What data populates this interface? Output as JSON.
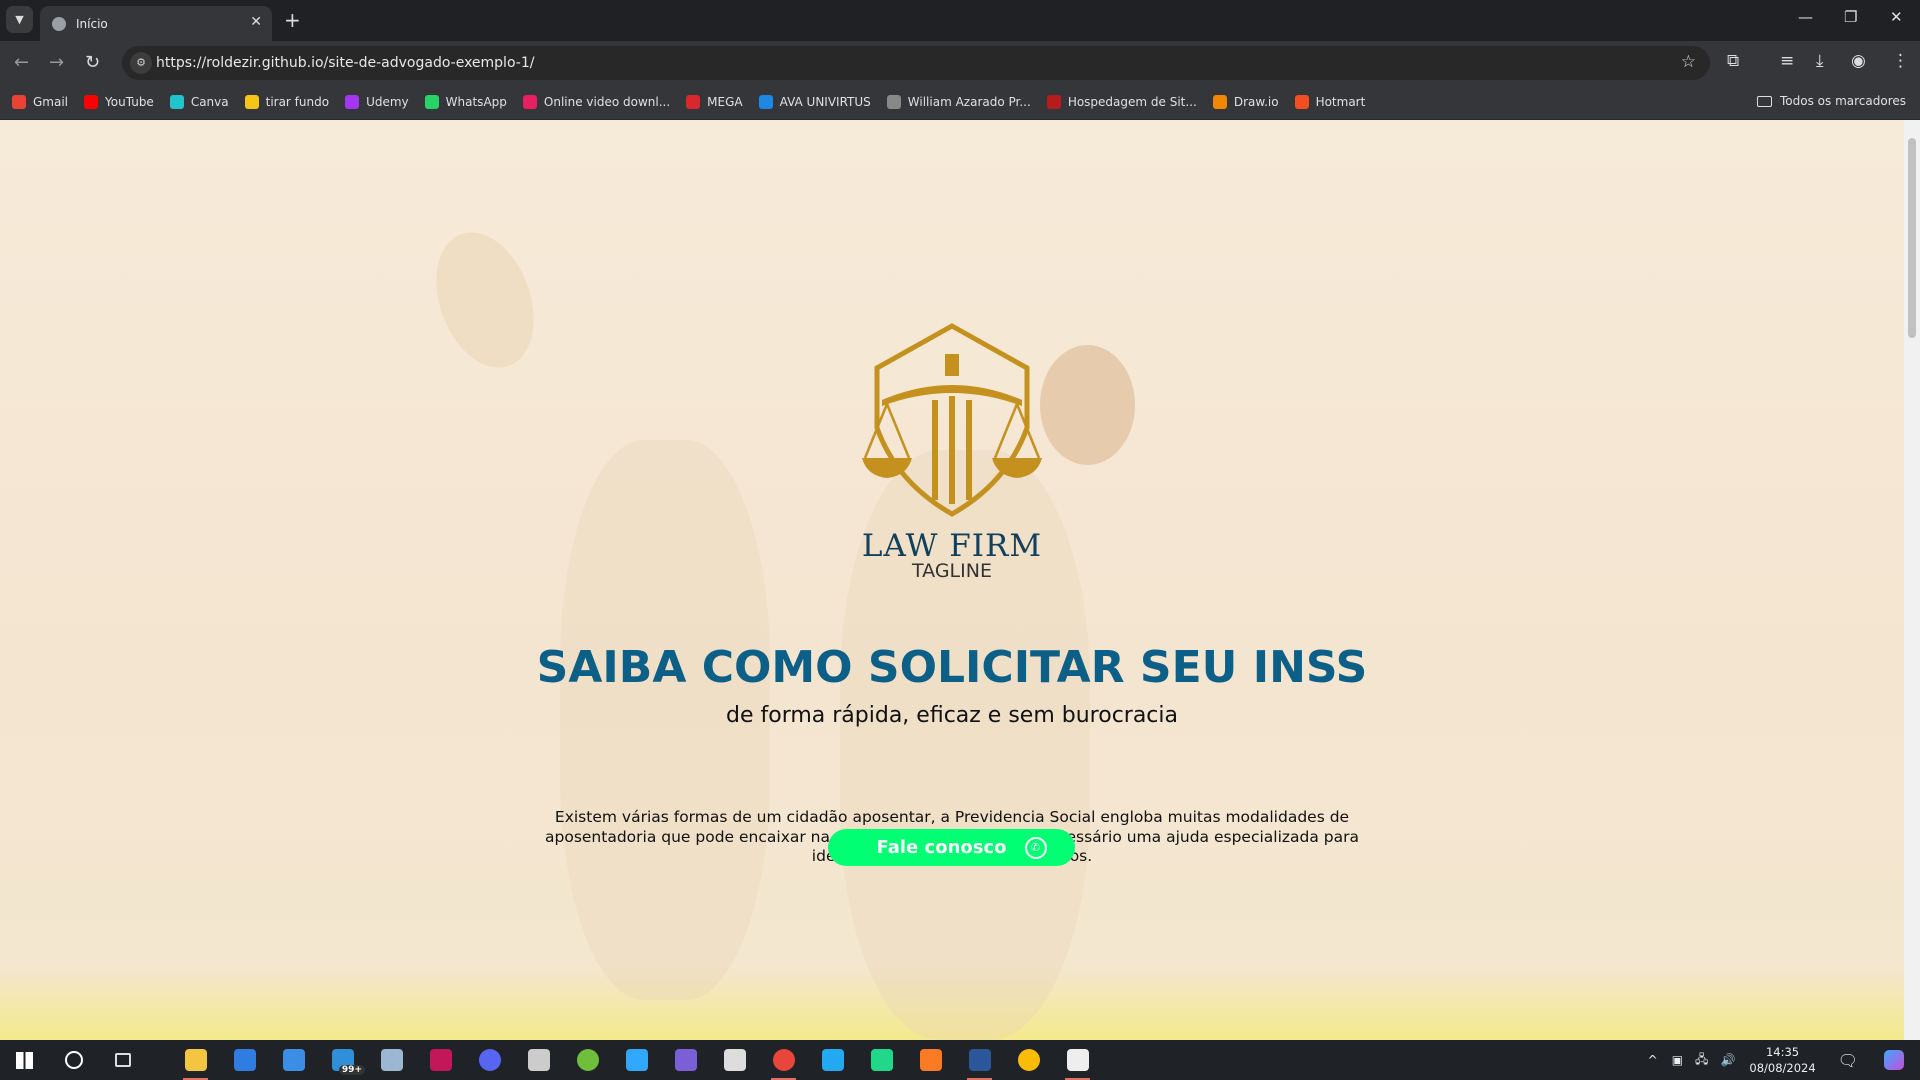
{
  "browser": {
    "tab_title": "Início",
    "url": "https://roldezir.github.io/site-de-advogado-exemplo-1/",
    "bookmarks": [
      {
        "label": "Gmail",
        "color": "#ea4335"
      },
      {
        "label": "YouTube",
        "color": "#ff0000"
      },
      {
        "label": "Canva",
        "color": "#20c4cb"
      },
      {
        "label": "tirar fundo",
        "color": "#f5c518"
      },
      {
        "label": "Udemy",
        "color": "#a435f0"
      },
      {
        "label": "WhatsApp",
        "color": "#25d366"
      },
      {
        "label": "Online video downl...",
        "color": "#e91e63"
      },
      {
        "label": "MEGA",
        "color": "#d9272e"
      },
      {
        "label": "AVA UNIVIRTUS",
        "color": "#1e88e5"
      },
      {
        "label": "William Azarado Pr...",
        "color": "#888888"
      },
      {
        "label": "Hospedagem de Sit...",
        "color": "#b71c1c"
      },
      {
        "label": "Draw.io",
        "color": "#f08705"
      },
      {
        "label": "Hotmart",
        "color": "#f04e23"
      }
    ],
    "all_bookmarks": "Todos os marcadores"
  },
  "page": {
    "logo_title": "LAW FIRM",
    "logo_tagline": "TAGLINE",
    "heading": "SAIBA COMO SOLICITAR SEU INSS",
    "subheading": "de forma rápida, eficaz e sem burocracia",
    "paragraph": "Existem várias formas de um cidadão aposentar, a Previdencia Social engloba muitas modalidades de aposentadoria que pode encaixar na sua situação atual, mas é necessário uma ajuda especializada para identificar e solicitar estes recursos.",
    "cta_label": "Fale conosco",
    "colors": {
      "gold": "#c4911f",
      "heading": "#0c5f86",
      "cta": "#00ff73"
    }
  },
  "taskbar": {
    "apps": [
      {
        "name": "file-explorer",
        "color": "#f4c542"
      },
      {
        "name": "app-blue",
        "color": "#2f7de1"
      },
      {
        "name": "store",
        "color": "#3a8ee6"
      },
      {
        "name": "mail",
        "color": "#2f8fd8"
      },
      {
        "name": "steam",
        "color": "#9bb7d4"
      },
      {
        "name": "app-vivaldi",
        "color": "#c2185b"
      },
      {
        "name": "discord",
        "color": "#5865f2"
      },
      {
        "name": "unity",
        "color": "#cccccc"
      },
      {
        "name": "utorrent",
        "color": "#6fbf3b"
      },
      {
        "name": "photoshop",
        "color": "#31a8ff"
      },
      {
        "name": "media-player",
        "color": "#7b5fd6"
      },
      {
        "name": "installer",
        "color": "#dddddd"
      },
      {
        "name": "chrome-active",
        "color": "#e8453c"
      },
      {
        "name": "vscode",
        "color": "#23a9f2"
      },
      {
        "name": "pycharm",
        "color": "#21d789"
      },
      {
        "name": "xampp",
        "color": "#fb7a24"
      },
      {
        "name": "word",
        "color": "#2b579a"
      },
      {
        "name": "chrome",
        "color": "#fbbc04"
      },
      {
        "name": "settings",
        "color": "#eeeeee"
      }
    ],
    "mail_badge": "99+",
    "time": "14:35",
    "date": "08/08/2024"
  }
}
